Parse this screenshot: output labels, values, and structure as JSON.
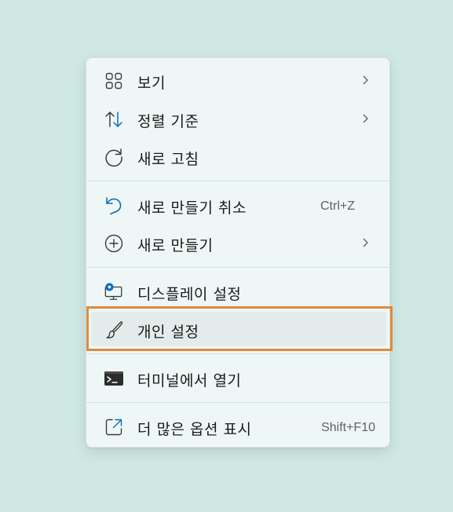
{
  "menu": {
    "items": [
      {
        "label": "보기",
        "icon": "grid-icon",
        "has_submenu": true
      },
      {
        "label": "정렬 기준",
        "icon": "sort-icon",
        "has_submenu": true
      },
      {
        "label": "새로 고침",
        "icon": "refresh-icon",
        "has_submenu": false
      },
      {
        "label": "새로 만들기 취소",
        "icon": "undo-icon",
        "shortcut": "Ctrl+Z"
      },
      {
        "label": "새로 만들기",
        "icon": "add-circle-icon",
        "has_submenu": true
      },
      {
        "label": "디스플레이 설정",
        "icon": "display-settings-icon"
      },
      {
        "label": "개인 설정",
        "icon": "paintbrush-icon",
        "highlighted": true
      },
      {
        "label": "터미널에서 열기",
        "icon": "terminal-icon"
      },
      {
        "label": "더 많은 옵션 표시",
        "icon": "open-external-icon",
        "shortcut": "Shift+F10"
      }
    ]
  },
  "colors": {
    "desktop_background": "#cfe8e4",
    "menu_background": "#eef7f6",
    "accent_blue": "#0f6cbd",
    "highlight_outline": "#e08a3c"
  }
}
